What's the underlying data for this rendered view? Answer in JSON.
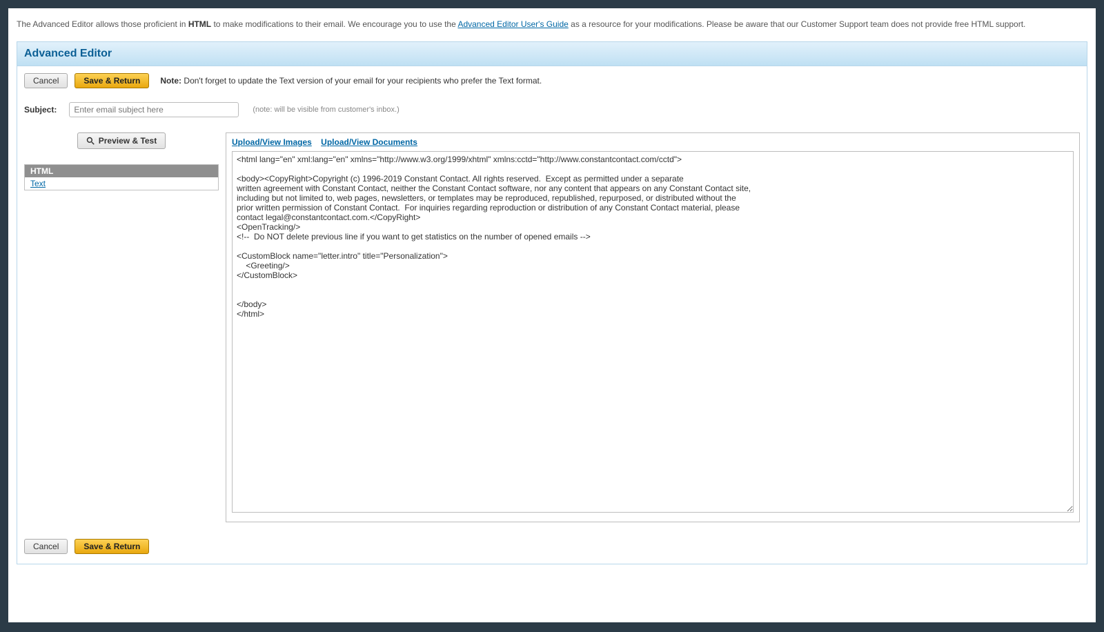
{
  "intro": {
    "prefix": "The Advanced Editor allows those proficient in ",
    "bold1": "HTML",
    "mid": " to make modifications to their email. We encourage you to use the ",
    "link_text": "Advanced Editor User's Guide",
    "suffix": " as a resource for your modifications. Please be aware that our Customer Support team does not provide free HTML support."
  },
  "header": {
    "title": "Advanced Editor"
  },
  "buttons": {
    "cancel": "Cancel",
    "save_return": "Save & Return",
    "preview_test": "Preview & Test"
  },
  "note": {
    "label": "Note:",
    "text": " Don't forget to update the Text version of your email for your recipients who prefer the Text format."
  },
  "subject": {
    "label": "Subject:",
    "placeholder": "Enter email subject here",
    "value": "Enter email subject here",
    "hint": "(note: will be visible from customer's inbox.)"
  },
  "tabs": {
    "html": "HTML",
    "text": "Text"
  },
  "links": {
    "upload_images": "Upload/View Images",
    "upload_docs": "Upload/View Documents"
  },
  "code": "<html lang=\"en\" xml:lang=\"en\" xmlns=\"http://www.w3.org/1999/xhtml\" xmlns:cctd=\"http://www.constantcontact.com/cctd\">\n\n<body><CopyRight>Copyright (c) 1996-2019 Constant Contact. All rights reserved.  Except as permitted under a separate\nwritten agreement with Constant Contact, neither the Constant Contact software, nor any content that appears on any Constant Contact site,\nincluding but not limited to, web pages, newsletters, or templates may be reproduced, republished, repurposed, or distributed without the\nprior written permission of Constant Contact.  For inquiries regarding reproduction or distribution of any Constant Contact material, please\ncontact legal@constantcontact.com.</CopyRight>\n<OpenTracking/>\n<!--  Do NOT delete previous line if you want to get statistics on the number of opened emails -->\n\n<CustomBlock name=\"letter.intro\" title=\"Personalization\">\n    <Greeting/>\n</CustomBlock>\n\n\n</body>\n</html>"
}
